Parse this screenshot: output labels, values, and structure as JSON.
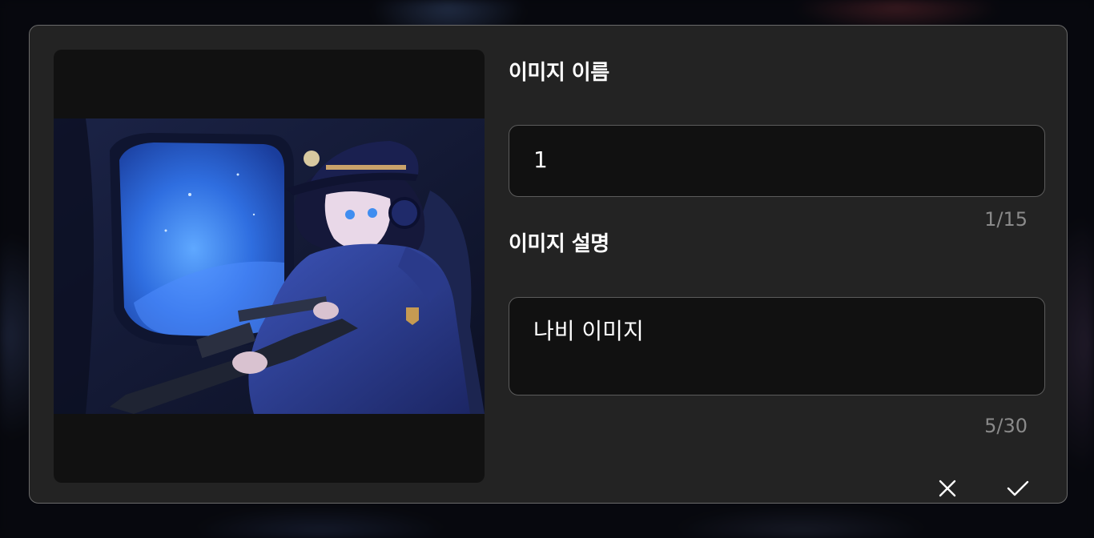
{
  "dialog": {
    "name_field": {
      "label": "이미지 이름",
      "value": "1",
      "counter": "1/15"
    },
    "description_field": {
      "label": "이미지 설명",
      "value": "나비 이미지",
      "counter": "5/30"
    },
    "actions": {
      "cancel_icon": "close-icon",
      "confirm_icon": "check-icon"
    }
  },
  "colors": {
    "dialog_bg": "#232323",
    "input_bg": "#111111",
    "border": "#5c5c5c",
    "text": "#ffffff",
    "muted_text": "#8a8a8a"
  }
}
